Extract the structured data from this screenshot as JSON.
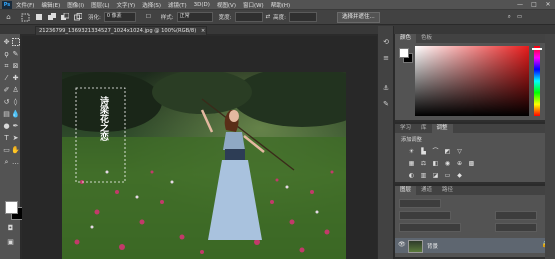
{
  "menubar": {
    "logo": "Ps",
    "items": [
      "文件(F)",
      "编辑(E)",
      "图像(I)",
      "图层(L)",
      "文字(Y)",
      "选择(S)",
      "滤镜(T)",
      "3D(D)",
      "视图(V)",
      "窗口(W)",
      "帮助(H)"
    ],
    "minimize": "—",
    "maximize": "□",
    "close": "✕"
  },
  "optionsbar": {
    "feather_label": "羽化:",
    "feather_value": "0 像素",
    "style_label": "样式:",
    "style_value": "正常",
    "width_label": "宽度:",
    "height_label": "高度:",
    "select_mask_button": "选择并遮住..."
  },
  "document": {
    "tab_title": "21236799_1369321334527_1024x1024.jpg @ 100%(RGB/8)",
    "close": "×"
  },
  "photo_text": "诗梁花之恋",
  "panels": {
    "color_tabs": [
      "颜色",
      "色板"
    ],
    "adjust_tabs": [
      "学习",
      "库",
      "调整"
    ],
    "adjust_subtitle": "添加调整",
    "layers_tabs": [
      "图层",
      "通道",
      "路径"
    ],
    "layer_name": "背景"
  },
  "colors": {
    "accent": "#31a8ff",
    "picker_hue": "#e81c1c",
    "foreground": "#ffffff",
    "background": "#000000"
  }
}
